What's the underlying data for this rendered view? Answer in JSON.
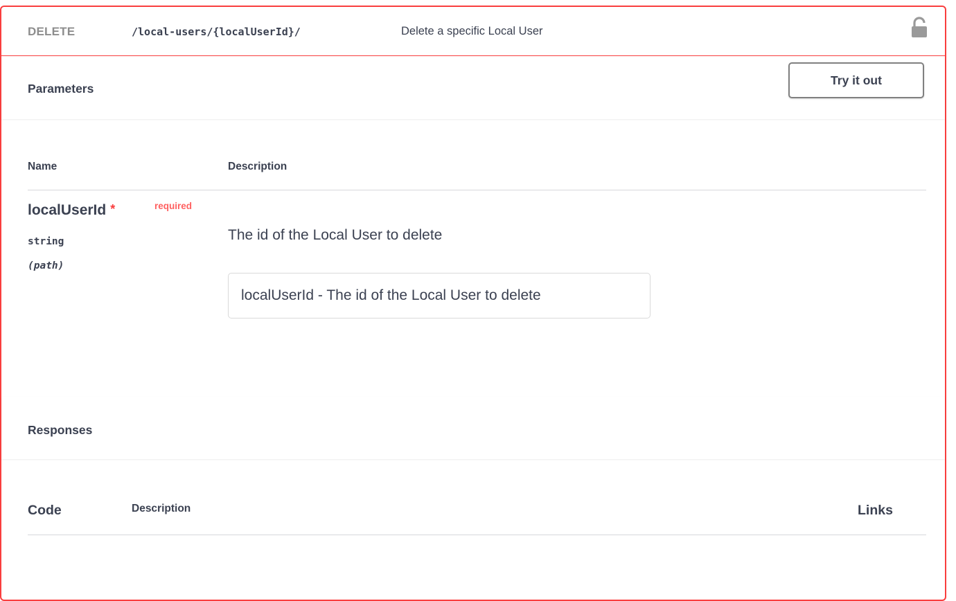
{
  "operation": {
    "method": "DELETE",
    "path": "/local-users/{localUserId}/",
    "summary": "Delete a specific Local User",
    "lock_icon": "unlocked-padlock-icon",
    "border_color": "#f93e3e"
  },
  "parameters": {
    "title": "Parameters",
    "try_button": "Try it out",
    "col_name": "Name",
    "col_description": "Description",
    "items": [
      {
        "name": "localUserId",
        "required_star": "*",
        "required_label": "required",
        "type": "string",
        "in": "(path)",
        "description": "The id of the Local User to delete",
        "placeholder": "localUserId - The id of the Local User to delete"
      }
    ]
  },
  "responses": {
    "title": "Responses",
    "col_code": "Code",
    "col_description": "Description",
    "col_links": "Links"
  }
}
